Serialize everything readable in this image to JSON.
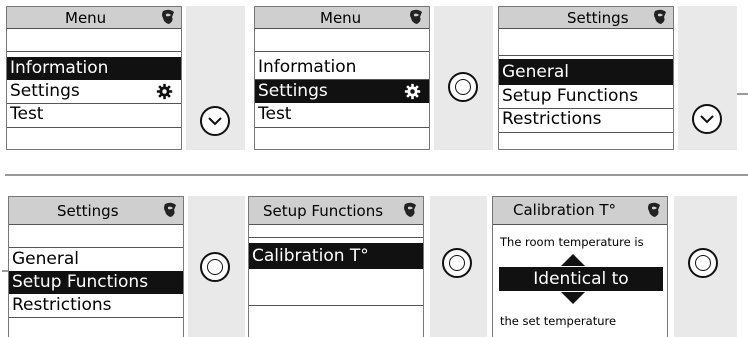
{
  "top_row": {
    "screen1": {
      "title": "Menu",
      "items": [
        "Information",
        "Settings",
        "Test"
      ]
    },
    "screen2": {
      "title": "Menu",
      "items": [
        "Information",
        "Settings",
        "Test"
      ]
    },
    "screen3": {
      "title": "Settings",
      "items": [
        "General",
        "Setup Functions",
        "Restrictions"
      ]
    }
  },
  "bottom_row": {
    "screen4": {
      "title": "Settings",
      "items": [
        "General",
        "Setup Functions",
        "Restrictions"
      ]
    },
    "screen5": {
      "title": "Setup Functions",
      "items": [
        "Calibration T°"
      ]
    },
    "screen6": {
      "title": "Calibration T°",
      "line1": "The room temperature is",
      "value": "Identical to",
      "line2": "the set temperature"
    }
  },
  "icons": {
    "logo": "leaf-drop-logo-icon",
    "gear": "gear-icon",
    "down": "chevron-down-circle-icon",
    "ok": "ok-circle-icon",
    "up": "triangle-up-icon",
    "downarrow": "triangle-down-icon"
  },
  "colors": {
    "titlebar": "#cfcfcf",
    "selection": "#111111",
    "panel": "#e9e9e9"
  }
}
